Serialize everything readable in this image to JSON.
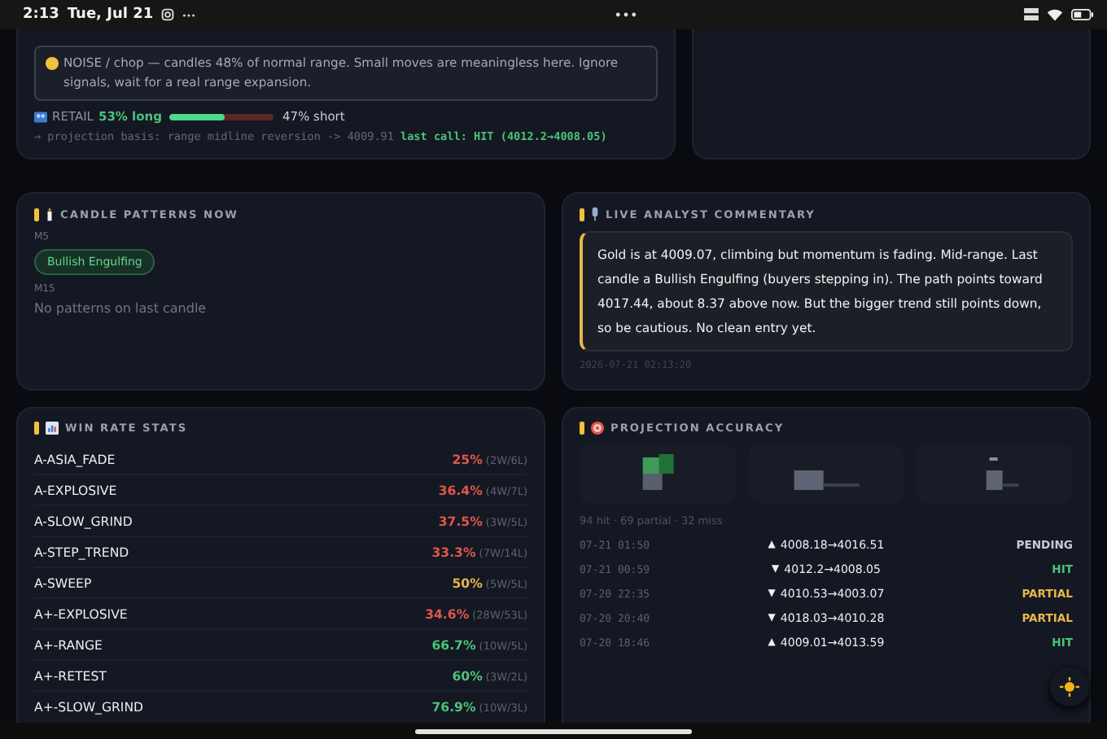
{
  "status_bar": {
    "time": "2:13",
    "date": "Tue, Jul 21"
  },
  "regime": {
    "note": "NOISE / chop — candles 48% of normal range. Small moves are meaningless here. Ignore signals, wait for a real range expansion.",
    "retail_label": "RETAIL",
    "long_text": "53% long",
    "level": 0.53,
    "short_text": "47% short",
    "basis": "→ projection basis: range midline reversion -> 4009.91",
    "last_call": "last call: HIT (4012.2→4008.05)"
  },
  "candle_patterns": {
    "title": "CANDLE PATTERNS NOW",
    "groups": [
      {
        "timeframe": "M5",
        "patterns": [
          "Bullish Engulfing"
        ]
      },
      {
        "timeframe": "M15",
        "empty_text": "No patterns on last candle"
      }
    ]
  },
  "commentary": {
    "title": "LIVE ANALYST COMMENTARY",
    "text": "Gold is at 4009.07, climbing but momentum is fading. Mid-range. Last candle a Bullish Engulfing (buyers stepping in). The path points toward 4017.44, about 8.37 above now. But the bigger trend still points down, so be cautious. No clean entry yet.",
    "timestamp": "2026-07-21 02:13:20"
  },
  "win_rate": {
    "title": "WIN RATE STATS",
    "rows": [
      {
        "name": "A-ASIA_FADE",
        "rate": "25%",
        "record": "(2W/6L)",
        "color": "#e0574c"
      },
      {
        "name": "A-EXPLOSIVE",
        "rate": "36.4%",
        "record": "(4W/7L)",
        "color": "#e0574c"
      },
      {
        "name": "A-SLOW_GRIND",
        "rate": "37.5%",
        "record": "(3W/5L)",
        "color": "#e0574c"
      },
      {
        "name": "A-STEP_TREND",
        "rate": "33.3%",
        "record": "(7W/14L)",
        "color": "#e0574c"
      },
      {
        "name": "A-SWEEP",
        "rate": "50%",
        "record": "(5W/5L)",
        "color": "#e8b64a"
      },
      {
        "name": "A+-EXPLOSIVE",
        "rate": "34.6%",
        "record": "(28W/53L)",
        "color": "#e0574c"
      },
      {
        "name": "A+-RANGE",
        "rate": "66.7%",
        "record": "(10W/5L)",
        "color": "#4cc27a"
      },
      {
        "name": "A+-RETEST",
        "rate": "60%",
        "record": "(3W/2L)",
        "color": "#4cc27a"
      },
      {
        "name": "A+-SLOW_GRIND",
        "rate": "76.9%",
        "record": "(10W/3L)",
        "color": "#4cc27a"
      }
    ]
  },
  "projection_accuracy": {
    "title": "PROJECTION ACCURACY",
    "summary": "94 hit · 69 partial · 32 miss",
    "rows": [
      {
        "time": "07-21 01:50",
        "direction": "▲",
        "range": "4008.18→4016.51",
        "status": "PENDING",
        "color": "#c9ccd3"
      },
      {
        "time": "07-21 00:59",
        "direction": "▼",
        "range": "4012.2→4008.05",
        "status": "HIT",
        "color": "#4cc27a"
      },
      {
        "time": "07-20 22:35",
        "direction": "▼",
        "range": "4010.53→4003.07",
        "status": "PARTIAL",
        "color": "#e8b64a"
      },
      {
        "time": "07-20 20:40",
        "direction": "▼",
        "range": "4018.03→4010.28",
        "status": "PARTIAL",
        "color": "#e8b64a"
      },
      {
        "time": "07-20 18:46",
        "direction": "▲",
        "range": "4009.01→4013.59",
        "status": "HIT",
        "color": "#4cc27a"
      }
    ]
  }
}
